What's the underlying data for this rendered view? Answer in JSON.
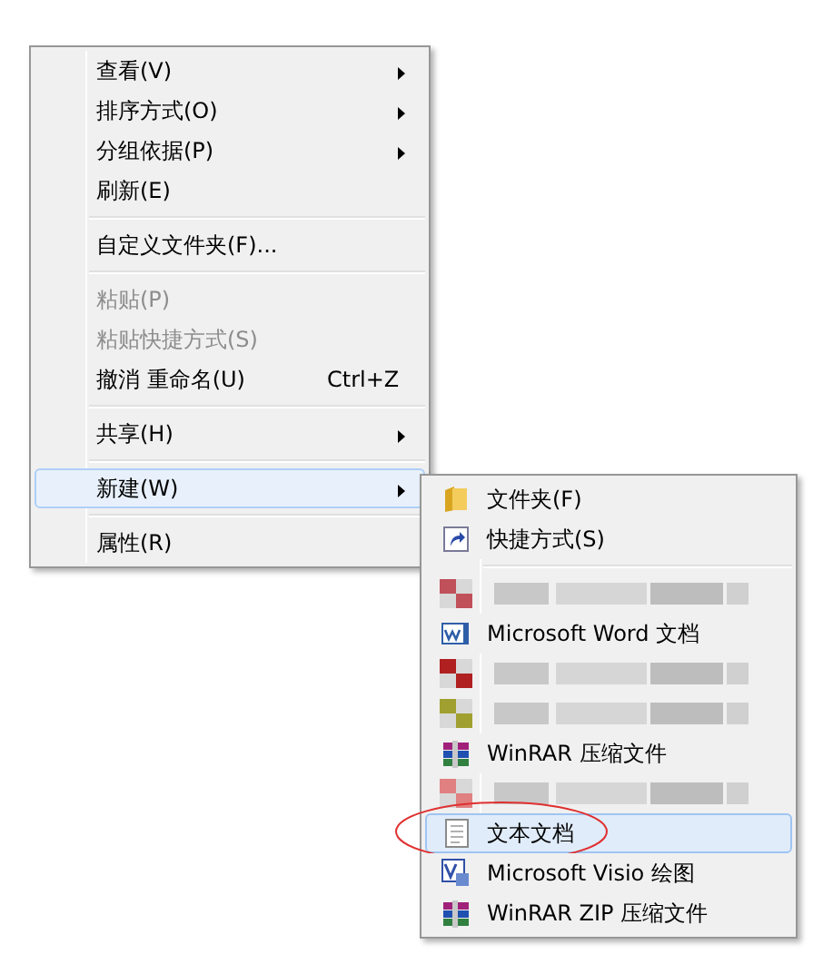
{
  "context_menu": {
    "groups": [
      [
        {
          "label": "查看(V)",
          "submenu": true,
          "disabled": false,
          "selected": false
        },
        {
          "label": "排序方式(O)",
          "submenu": true,
          "disabled": false,
          "selected": false
        },
        {
          "label": "分组依据(P)",
          "submenu": true,
          "disabled": false,
          "selected": false
        },
        {
          "label": "刷新(E)",
          "submenu": false,
          "disabled": false,
          "selected": false
        }
      ],
      [
        {
          "label": "自定义文件夹(F)...",
          "submenu": false,
          "disabled": false,
          "selected": false
        }
      ],
      [
        {
          "label": "粘贴(P)",
          "submenu": false,
          "disabled": true,
          "selected": false
        },
        {
          "label": "粘贴快捷方式(S)",
          "submenu": false,
          "disabled": true,
          "selected": false
        },
        {
          "label": "撤消 重命名(U)",
          "shortcut": "Ctrl+Z",
          "submenu": false,
          "disabled": false,
          "selected": false
        }
      ],
      [
        {
          "label": "共享(H)",
          "submenu": true,
          "disabled": false,
          "selected": false
        }
      ],
      [
        {
          "label": "新建(W)",
          "submenu": true,
          "disabled": false,
          "selected": true
        }
      ],
      [
        {
          "label": "属性(R)",
          "submenu": false,
          "disabled": false,
          "selected": false
        }
      ]
    ]
  },
  "new_submenu": {
    "groups": [
      [
        {
          "kind": "folder",
          "label": "文件夹(F)",
          "selected": false
        },
        {
          "kind": "shortcut",
          "label": "快捷方式(S)",
          "selected": false
        }
      ],
      [
        {
          "kind": "blurred",
          "color": "#c0505a"
        },
        {
          "kind": "word",
          "label": "Microsoft Word 文档",
          "selected": false
        },
        {
          "kind": "blurred",
          "color": "#b02020"
        },
        {
          "kind": "blurred",
          "color": "#a0a030"
        },
        {
          "kind": "winrar",
          "label": "WinRAR 压缩文件",
          "selected": false
        },
        {
          "kind": "blurred",
          "color": "#e08080"
        },
        {
          "kind": "text",
          "label": "文本文档",
          "selected": true,
          "circled": true
        },
        {
          "kind": "visio",
          "label": "Microsoft Visio 绘图",
          "selected": false
        },
        {
          "kind": "winrar",
          "label": "WinRAR ZIP 压缩文件",
          "selected": false
        }
      ]
    ]
  }
}
